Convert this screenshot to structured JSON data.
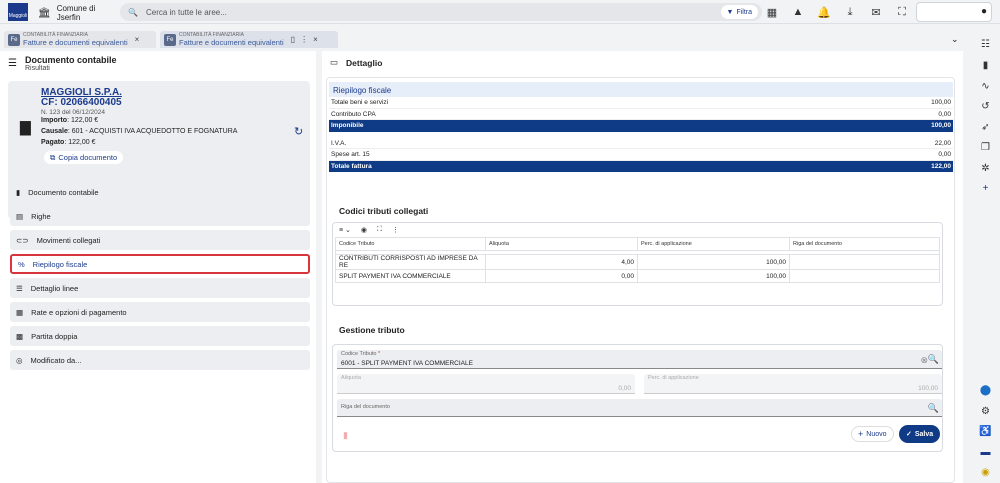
{
  "topbar": {
    "municipality_line1": "Comune di",
    "municipality_line2": "Jserfin",
    "search_placeholder": "Cerca in tutte le aree...",
    "filter_label": "Filtra",
    "logo_text": "Maggioli"
  },
  "tabs": [
    {
      "subtitle": "CONTABILITÀ FINANZIARIA",
      "title": "Fatture e documenti equivalenti",
      "badge": "Fe"
    },
    {
      "subtitle": "CONTABILITÀ FINANZIARIA",
      "title": "Fatture e documenti equivalenti",
      "badge": "Fe"
    }
  ],
  "left": {
    "title": "Documento contabile",
    "subtitle": "Risultati",
    "card": {
      "name": "MAGGIOLI S.P.A.",
      "cf": "CF: 02066400405",
      "number": "N. 123 del 06/12/2024",
      "importo_label": "Importo",
      "importo_value": ": 122,00 €",
      "causale_label": "Causale",
      "causale_value": ": 601 - ACQUISTI IVA ACQUEDOTTO E FOGNATURA",
      "pagato_label": "Pagato",
      "pagato_value": ": 122,00 €",
      "copy_label": "Copia documento"
    },
    "menu": [
      {
        "label": "Documento contabile",
        "icon": "document-icon"
      },
      {
        "label": "Righe",
        "icon": "rows-icon"
      },
      {
        "label": "Movimenti collegati",
        "icon": "link-icon"
      },
      {
        "label": "Riepilogo fiscale",
        "icon": "percent-icon"
      },
      {
        "label": "Dettaglio linee",
        "icon": "list-icon"
      },
      {
        "label": "Rate e opzioni di pagamento",
        "icon": "qr-icon"
      },
      {
        "label": "Partita doppia",
        "icon": "calculator-icon"
      },
      {
        "label": "Modificato da...",
        "icon": "fingerprint-icon"
      }
    ]
  },
  "right": {
    "title": "Dettaglio",
    "riepilogo": {
      "header": "Riepilogo fiscale",
      "rows1": [
        {
          "label": "Totale beni e servizi",
          "value": "100,00"
        },
        {
          "label": "Contributo CPA",
          "value": "0,00"
        }
      ],
      "imponibile": {
        "label": "Imponibile",
        "value": "100,00"
      },
      "rows2": [
        {
          "label": "I.V.A.",
          "value": "22,00"
        },
        {
          "label": "Spese art. 15",
          "value": "0,00"
        }
      ],
      "totale": {
        "label": "Totale fattura",
        "value": "122,00"
      }
    },
    "codici": {
      "title": "Codici tributi collegati",
      "columns": [
        "Codice Tributo",
        "Aliquota",
        "Perc. di applicazione",
        "Riga del documento"
      ],
      "rows": [
        [
          "CONTRIBUTI CORRISPOSTI AD IMPRESE DA RE",
          "4,00",
          "100,00",
          ""
        ],
        [
          "SPLIT PAYMENT IVA COMMERCIALE",
          "0,00",
          "100,00",
          ""
        ]
      ]
    },
    "gestione": {
      "title": "Gestione tributo",
      "codice_label": "Codice Tributo",
      "codice_value": "6001 - SPLIT PAYMENT IVA COMMERCIALE",
      "aliquota_label": "Aliquota",
      "aliquota_value": "0,00",
      "perc_label": "Perc. di applicazione",
      "perc_value": "100,00",
      "riga_label": "Riga del documento",
      "nuovo_label": "Nuovo",
      "salva_label": "Salva"
    }
  },
  "colors": {
    "brand": "#0f3a86",
    "highlight": "#d7343b"
  }
}
